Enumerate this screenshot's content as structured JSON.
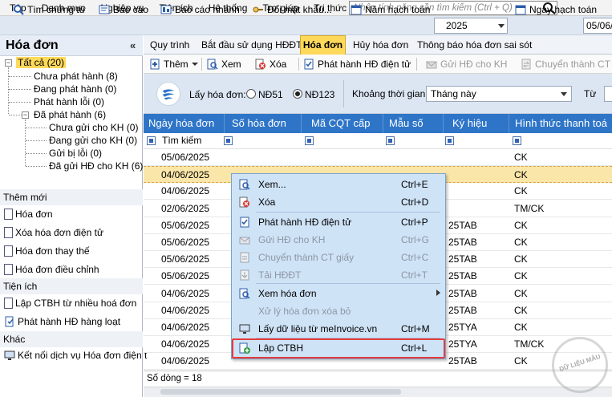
{
  "menubar": {
    "items": [
      "Tệp",
      "Danh mục",
      "Nghiệp vụ",
      "Tiện ích",
      "Hệ thống",
      "Trợ giúp",
      "Tri thức"
    ],
    "search_placeholder": "Nhập tính năng cần tìm kiếm (Ctrl + Q)"
  },
  "toolbar": {
    "find_voucher": "Tìm chứng từ",
    "report": "Báo cáo",
    "quick_report": "Báo cáo nhanh",
    "change_password": "Đổi mật khẩu...",
    "fiscal_year_label": "Năm hạch toán",
    "fiscal_year": "2025",
    "posting_date_label": "Ngày hạch toán",
    "posting_date": "05/06/"
  },
  "sidebar": {
    "title": "Hóa đơn",
    "collapse": "«",
    "tree": {
      "all": "Tất cả (20)",
      "not_issued": "Chưa phát hành (8)",
      "issuing": "Đang phát hành (0)",
      "issue_error": "Phát hành lỗi (0)",
      "issued": "Đã phát hành (6)",
      "not_sent": "Chưa gửi cho KH (0)",
      "sending": "Đang gửi cho KH (0)",
      "send_error": "Gửi bị lỗi (0)",
      "sent": "Đã gửi HĐ cho KH (6)"
    },
    "sections": {
      "new": {
        "title": "Thêm mới",
        "items": [
          "Hóa đơn",
          "Xóa hóa đơn điện tử",
          "Hóa đơn thay thế",
          "Hóa đơn điều chỉnh"
        ]
      },
      "utilities": {
        "title": "Tiện ích",
        "items": [
          "Lập CTBH từ nhiều hoá đơn",
          "Phát hành HĐ hàng loạt"
        ]
      },
      "other": {
        "title": "Khác",
        "items": [
          "Kết nối dịch vụ Hóa đơn điện t"
        ]
      }
    }
  },
  "tabs": [
    "Quy trình",
    "Bắt đầu sử dụng HĐĐT",
    "Hóa đơn",
    "Hủy hóa đơn",
    "Thông báo hóa đơn sai sót"
  ],
  "active_tab": "Hóa đơn",
  "actions": {
    "add": "Thêm",
    "view": "Xem",
    "delete": "Xóa",
    "issue": "Phát hành HĐ điện tử",
    "send": "Gửi HĐ cho KH",
    "convert": "Chuyển thành CT gi"
  },
  "filter": {
    "get_invoice_label": "Lấy hóa đơn:",
    "option_nd51": "NĐ51",
    "option_nd123": "NĐ123",
    "selected_option": "NĐ123",
    "period_label": "Khoảng thời gian",
    "period_value": "Tháng này",
    "from_label": "Từ"
  },
  "grid": {
    "columns": [
      "Ngày hóa đơn",
      "Số hóa đơn",
      "Mã CQT cấp",
      "Mẫu số",
      "Ký hiệu",
      "Hình thức thanh toá"
    ],
    "filter_placeholder": "Tìm kiếm",
    "rows": [
      {
        "date": "05/06/2025",
        "number": "",
        "cqt": "",
        "form": "",
        "symbol": "",
        "payment": "CK"
      },
      {
        "date": "04/06/2025",
        "number": "",
        "cqt": "",
        "form": "",
        "symbol": "",
        "payment": "CK"
      },
      {
        "date": "04/06/2025",
        "number": "",
        "cqt": "",
        "form": "",
        "symbol": "",
        "payment": "CK"
      },
      {
        "date": "02/06/2025",
        "number": "",
        "cqt": "",
        "form": "",
        "symbol": "",
        "payment": "TM/CK"
      },
      {
        "date": "05/06/2025",
        "number": "",
        "cqt": "",
        "form": "",
        "symbol": "25TAB",
        "payment": "CK"
      },
      {
        "date": "05/06/2025",
        "number": "",
        "cqt": "",
        "form": "",
        "symbol": "25TAB",
        "payment": "CK"
      },
      {
        "date": "05/06/2025",
        "number": "",
        "cqt": "",
        "form": "",
        "symbol": "25TAB",
        "payment": "CK"
      },
      {
        "date": "05/06/2025",
        "number": "",
        "cqt": "",
        "form": "",
        "symbol": "25TAB",
        "payment": "CK"
      },
      {
        "date": "04/06/2025",
        "number": "",
        "cqt": "",
        "form": "",
        "symbol": "25TAB",
        "payment": "CK"
      },
      {
        "date": "04/06/2025",
        "number": "",
        "cqt": "",
        "form": "",
        "symbol": "25TAB",
        "payment": "CK"
      },
      {
        "date": "04/06/2025",
        "number": "",
        "cqt": "",
        "form": "",
        "symbol": "25TYA",
        "payment": "CK"
      },
      {
        "date": "04/06/2025",
        "number": "",
        "cqt": "",
        "form": "",
        "symbol": "25TYA",
        "payment": "TM/CK"
      },
      {
        "date": "04/06/2025",
        "number": "",
        "cqt": "",
        "form": "",
        "symbol": "25TAB",
        "payment": "CK"
      }
    ],
    "row_count_label": "Số dòng = 18"
  },
  "context_menu": {
    "items": [
      {
        "label": "Xem...",
        "shortcut": "Ctrl+E",
        "enabled": true,
        "icon": "view-icon"
      },
      {
        "label": "Xóa",
        "shortcut": "Ctrl+D",
        "enabled": true,
        "icon": "delete-icon"
      },
      {
        "label": "Phát hành HĐ điện tử",
        "shortcut": "Ctrl+P",
        "enabled": true,
        "icon": "issue-icon"
      },
      {
        "label": "Gửi HĐ cho KH",
        "shortcut": "Ctrl+G",
        "enabled": false,
        "icon": "send-icon"
      },
      {
        "label": "Chuyển thành CT giấy",
        "shortcut": "Ctrl+C",
        "enabled": false,
        "icon": "convert-icon"
      },
      {
        "label": "Tải HĐĐT",
        "shortcut": "Ctrl+T",
        "enabled": false,
        "icon": "download-icon"
      },
      {
        "label": "Xem hóa đơn",
        "shortcut": "",
        "enabled": true,
        "icon": "view-invoice-icon"
      },
      {
        "label": "Xử lý hóa đơn xóa bỏ",
        "shortcut": "",
        "enabled": false,
        "icon": ""
      },
      {
        "label": "Lấy dữ liệu từ meInvoice.vn",
        "shortcut": "Ctrl+M",
        "enabled": true,
        "icon": "monitor-icon"
      },
      {
        "label": "Lập CTBH",
        "shortcut": "Ctrl+L",
        "enabled": true,
        "icon": "create-voucher-icon"
      }
    ]
  },
  "watermark": "DỮ LIỆU MẪU",
  "colors": {
    "grid_header": "#2e75c8",
    "active_tab": "#ffd95a",
    "selected_row": "#fbe6a9",
    "context_menu_bg": "#cfe3f7",
    "highlight_border": "#e23d3d"
  }
}
